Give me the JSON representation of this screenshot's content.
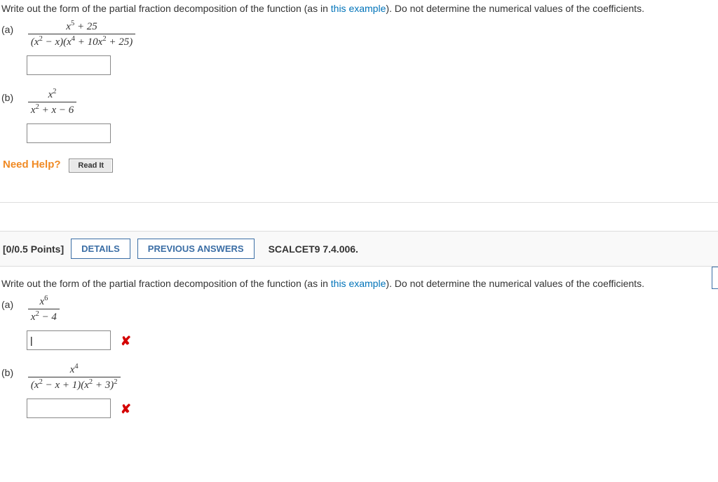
{
  "q1": {
    "prompt_pre": "Write out the form of the partial fraction decomposition of the function (as in ",
    "prompt_link": "this example",
    "prompt_post": "). Do not determine the numerical values of the coefficients.",
    "parts": {
      "a": {
        "label": "(a)",
        "num": "x⁵ + 25",
        "den": "(x² − x)(x⁴ + 10x² + 25)"
      },
      "b": {
        "label": "(b)",
        "num": "x²",
        "den": "x² + x − 6"
      }
    },
    "need_help": "Need Help?",
    "read_it": "Read It"
  },
  "q2": {
    "header": {
      "points": "[0/0.5 Points]",
      "details": "DETAILS",
      "prev": "PREVIOUS ANSWERS",
      "source": "SCALCET9 7.4.006."
    },
    "prompt_pre": "Write out the form of the partial fraction decomposition of the function (as in ",
    "prompt_link": "this example",
    "prompt_post": "). Do not determine the numerical values of the coefficients.",
    "parts": {
      "a": {
        "label": "(a)",
        "num": "x⁶",
        "den": "x² − 4"
      },
      "b": {
        "label": "(b)",
        "num": "x⁴",
        "den": "(x² − x + 1)(x² + 3)²"
      }
    }
  }
}
